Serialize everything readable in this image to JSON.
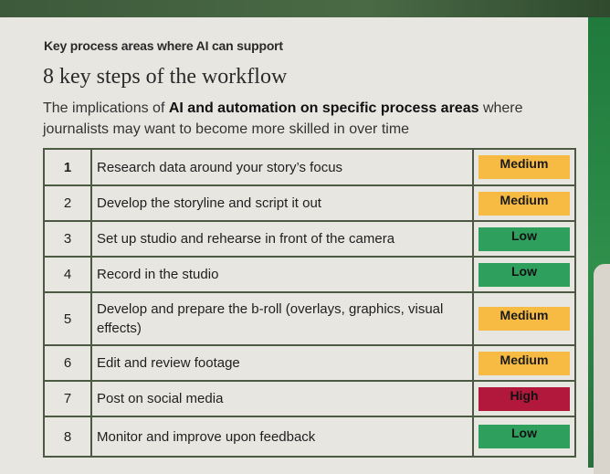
{
  "header": {
    "kicker": "Key process areas where AI can support",
    "title": "8 key steps of the workflow",
    "subtitle_pre": "The implications of ",
    "subtitle_bold": "AI and automation on specific process areas",
    "subtitle_post": " where journalists may want to become more skilled in over time"
  },
  "colors": {
    "Medium": "#f7bb44",
    "Low": "#2f9f5e",
    "High": "#b2173c",
    "text_on_Medium": "#1a1a1a",
    "text_on_Low": "#111111",
    "text_on_High": "#111111"
  },
  "steps": [
    {
      "num": "1",
      "task": "Research data around your story’s focus",
      "level": "Medium"
    },
    {
      "num": "2",
      "task": "Develop the storyline and script it out",
      "level": "Medium"
    },
    {
      "num": "3",
      "task": "Set up studio and rehearse in front of the camera",
      "level": "Low"
    },
    {
      "num": "4",
      "task": "Record in the studio",
      "level": "Low"
    },
    {
      "num": "5",
      "task": "Develop and prepare the b-roll (overlays, graphics, visual effects)",
      "level": "Medium"
    },
    {
      "num": "6",
      "task": "Edit and review footage",
      "level": "Medium"
    },
    {
      "num": "7",
      "task": "Post on social media",
      "level": "High"
    },
    {
      "num": "8",
      "task": "Monitor and improve upon feedback",
      "level": "Low"
    }
  ]
}
